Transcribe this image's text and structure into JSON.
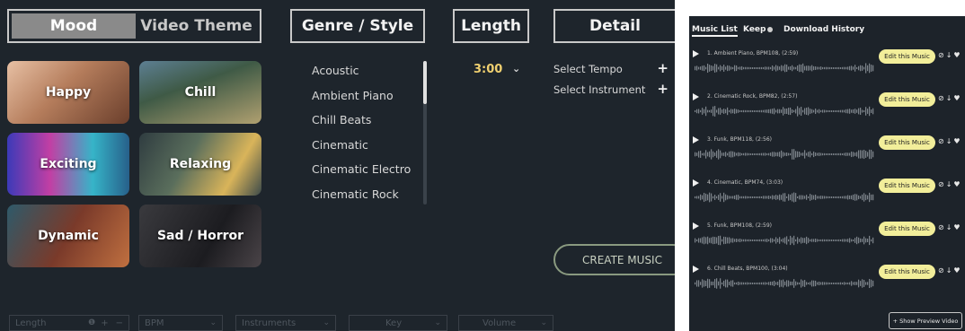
{
  "left": {
    "tabs": {
      "mood": "Mood",
      "video_theme": "Video Theme"
    },
    "headers": {
      "genre": "Genre / Style",
      "length": "Length",
      "detail": "Detail"
    },
    "moods": [
      "Happy",
      "Chill",
      "Exciting",
      "Relaxing",
      "Dynamic",
      "Sad / Horror"
    ],
    "genres": [
      "Acoustic",
      "Ambient Piano",
      "Chill Beats",
      "Cinematic",
      "Cinematic Electro",
      "Cinematic Rock"
    ],
    "length": {
      "value": "3:00",
      "chevron": "⌄"
    },
    "detail": {
      "tempo": "Select Tempo",
      "instrument": "Select Instrument",
      "plus": "+"
    },
    "create_button": "CREATE MUSIC",
    "filters": {
      "length": "Length",
      "bpm": "BPM",
      "instruments": "Instruments",
      "key": "Key",
      "volume": "Volume"
    },
    "filter_controls": {
      "plus": "+",
      "minus": "−",
      "chevron": "⌄",
      "info": "❶"
    }
  },
  "right": {
    "tabs": {
      "music_list": "Music List",
      "keep": "Keep",
      "download_history": "Download History"
    },
    "edit_label": "Edit this Music",
    "track_icons": {
      "link": "⊘",
      "download": "↓",
      "heart": "♥"
    },
    "tracks": [
      "1. Ambient Piano, BPM108, (2:59)",
      "2. Cinematic Rock, BPM82, (2:57)",
      "3. Funk, BPM118, (2:56)",
      "4. Cinematic, BPM74, (3:03)",
      "5. Funk, BPM108, (2:59)",
      "6. Chill Beats, BPM100, (3:04)"
    ],
    "preview_button": "+ Show Preview Video"
  }
}
